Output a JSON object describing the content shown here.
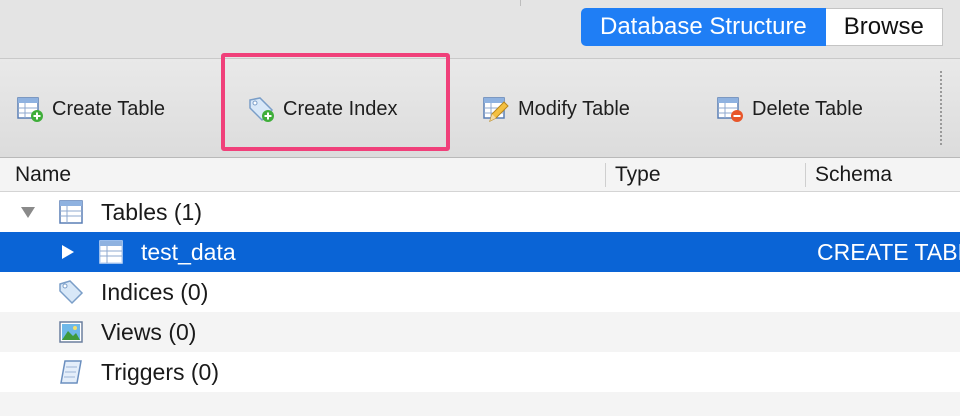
{
  "tabs": {
    "database_structure": "Database Structure",
    "browse": "Browse"
  },
  "toolbar": {
    "create_table": "Create Table",
    "create_index": "Create Index",
    "modify_table": "Modify Table",
    "delete_table": "Delete Table"
  },
  "columns": {
    "name": "Name",
    "type": "Type",
    "schema": "Schema"
  },
  "tree": {
    "tables": "Tables (1)",
    "test_data": "test_data",
    "test_data_schema": "CREATE TABLE",
    "indices": "Indices (0)",
    "views": "Views (0)",
    "triggers": "Triggers (0)"
  },
  "colors": {
    "accent": "#1f7ef5",
    "selection": "#0a64d6",
    "highlight": "#f0407a"
  }
}
